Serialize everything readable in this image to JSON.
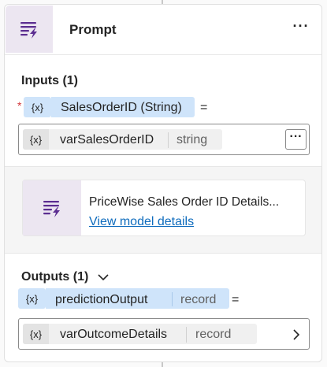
{
  "node": {
    "title": "Prompt",
    "more_label": "···",
    "icon": "prompt-icon"
  },
  "inputs": {
    "label": "Inputs (1)",
    "required_mark": "*",
    "var_tag": "{x}",
    "param_text": "SalesOrderID (String)",
    "equals": "=",
    "value_tag": "{x}",
    "value_name": "varSalesOrderID",
    "value_type": "string",
    "more_label": "···"
  },
  "model": {
    "name": "PriceWise Sales Order ID Details...",
    "link": "View model details",
    "icon": "prompt-icon"
  },
  "outputs": {
    "label": "Outputs (1)",
    "var_tag": "{x}",
    "name": "predictionOutput",
    "type": "record",
    "equals": "=",
    "value_tag": "{x}",
    "value_name": "varOutcomeDetails",
    "value_type": "record",
    "chevron": "chevron-right-icon"
  },
  "colors": {
    "accent_tag": "#cfe4fa",
    "icon_bg": "#ece6f1",
    "icon_fg": "#5c2e91",
    "link": "#0f6cbd",
    "required": "#d13438"
  }
}
